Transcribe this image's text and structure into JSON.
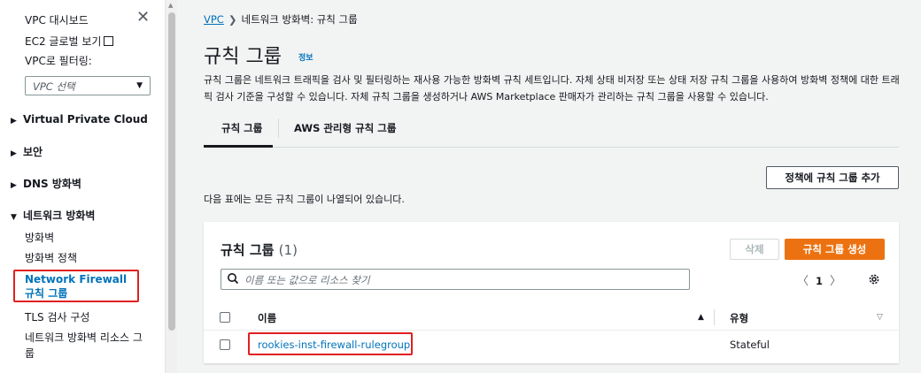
{
  "sidebar": {
    "dashboard": "VPC 대시보드",
    "ec2_global": "EC2 글로벌 보기",
    "filter_label": "VPC로 필터링:",
    "vpc_select_placeholder": "VPC 선택",
    "sections": [
      {
        "label": "Virtual Private Cloud",
        "state": "collapsed"
      },
      {
        "label": "보안",
        "state": "collapsed"
      },
      {
        "label": "DNS 방화벽",
        "state": "collapsed"
      },
      {
        "label": "네트워크 방화벽",
        "state": "expanded"
      }
    ],
    "items": [
      {
        "label": "방화벽"
      },
      {
        "label": "방화벽 정책"
      },
      {
        "label": "Network Firewall 규칙 그룹",
        "active": true
      },
      {
        "label": "TLS 검사 구성"
      },
      {
        "label": "네트워크 방화벽 리소스 그룹"
      }
    ]
  },
  "breadcrumb": {
    "root": "VPC",
    "current": "네트워크 방화벽: 규칙 그룹"
  },
  "page": {
    "title": "규칙 그룹",
    "info": "정보",
    "description": "규칙 그룹은 네트워크 트래픽을 검사 및 필터링하는 재사용 가능한 방화벽 규칙 세트입니다. 자체 상태 비저장 또는 상태 저장 규칙 그룹을 사용하여 방화벽 정책에 대한 트래픽 검사 기준을 구성할 수 있습니다. 자체 규칙 그룹을 생성하거나 AWS Marketplace 판매자가 관리하는 규칙 그룹을 사용할 수 있습니다."
  },
  "tabs": [
    {
      "label": "규칙 그룹",
      "active": true
    },
    {
      "label": "AWS 관리형 규칙 그룹",
      "active": false
    }
  ],
  "add_to_policy_button": "정책에 규칙 그룹 추가",
  "table_note": "다음 표에는 모든 규칙 그룹이 나열되어 있습니다.",
  "panel": {
    "title": "규칙 그룹",
    "count": "(1)",
    "delete_button": "삭제",
    "create_button": "규칙 그룹 생성",
    "search_placeholder": "이름 또는 값으로 리소스 찾기",
    "page_number": "1",
    "columns": [
      "이름",
      "유형"
    ],
    "rows": [
      {
        "name": "rookies-inst-firewall-rulegroup",
        "type": "Stateful"
      }
    ]
  },
  "colors": {
    "link": "#0073bb",
    "primary": "#ec7211",
    "highlight": "#e02020"
  }
}
